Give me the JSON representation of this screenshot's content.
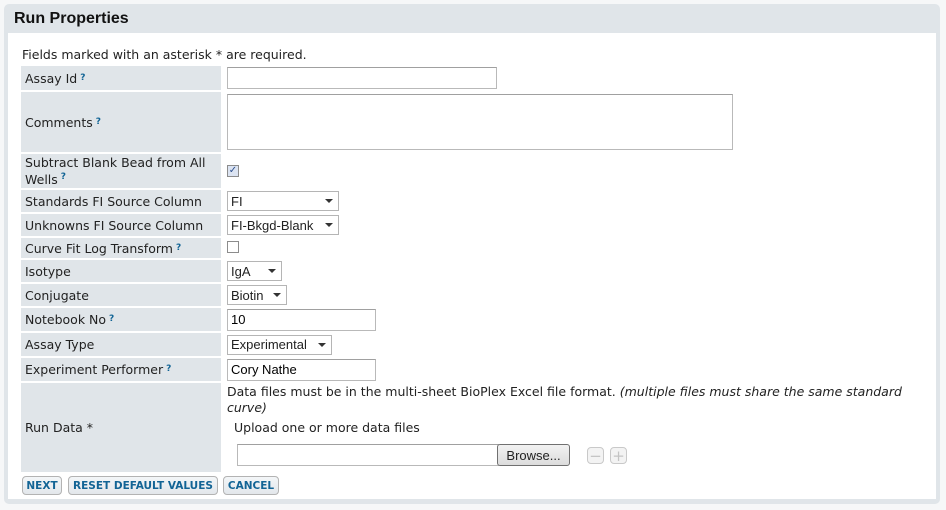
{
  "panel": {
    "title": "Run Properties"
  },
  "required_note": "Fields marked with an asterisk * are required.",
  "help_glyph": "?",
  "fields": {
    "assay_id": {
      "label": "Assay Id",
      "value": ""
    },
    "comments": {
      "label": "Comments",
      "value": ""
    },
    "subtract_blank": {
      "label": "Subtract Blank Bead from All Wells",
      "checked": true,
      "check_glyph": "✓"
    },
    "standards_fi": {
      "label": "Standards FI Source Column",
      "value": "FI"
    },
    "unknowns_fi": {
      "label": "Unknowns FI Source Column",
      "value": "FI-Bkgd-Blank"
    },
    "curve_fit": {
      "label": "Curve Fit Log Transform",
      "checked": false
    },
    "isotype": {
      "label": "Isotype",
      "value": "IgA"
    },
    "conjugate": {
      "label": "Conjugate",
      "value": "Biotin"
    },
    "notebook_no": {
      "label": "Notebook No",
      "value": "10"
    },
    "assay_type": {
      "label": "Assay Type",
      "value": "Experimental"
    },
    "experiment_performer": {
      "label": "Experiment Performer",
      "value": "Cory Nathe"
    },
    "run_data": {
      "label": "Run Data *",
      "description": "Data files must be in the multi-sheet BioPlex Excel file format.",
      "description_note": "(multiple files must share the same standard curve)",
      "upload_label": "Upload one or more data files",
      "file_value": "",
      "browse_label": "Browse...",
      "remove_glyph": "−",
      "add_glyph": "+"
    }
  },
  "buttons": {
    "next": "NEXT",
    "reset": "RESET DEFAULT VALUES",
    "cancel": "CANCEL"
  }
}
